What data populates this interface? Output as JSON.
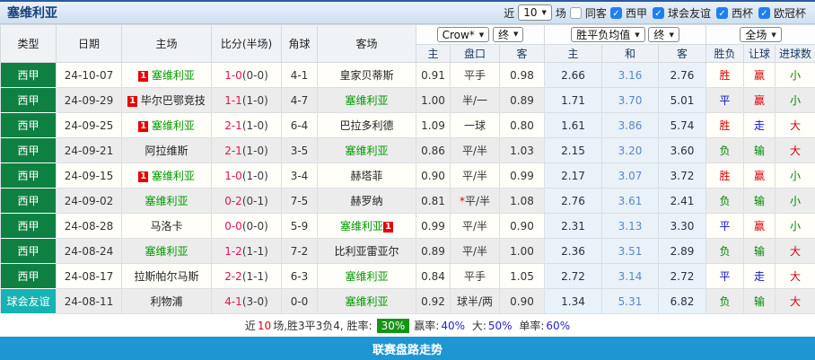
{
  "icons": {
    "caret_down": "▼",
    "check": "✓"
  },
  "title_bar": {
    "team": "塞维利亚",
    "recent_label": "近",
    "recent_value": "10",
    "recent_suffix": "场",
    "same_away_label": "同客",
    "leagues": [
      "西甲",
      "球会友谊",
      "西杯",
      "欧冠杯"
    ]
  },
  "table": {
    "main_headers": [
      "类型",
      "日期",
      "主场",
      "比分(半场)",
      "角球",
      "客场"
    ],
    "selects": {
      "bookmaker": "Crow*",
      "final1": "终",
      "avg_label": "胜平负均值",
      "final2": "终",
      "scope": "全场"
    },
    "sub_headers": [
      "主",
      "盘口",
      "客",
      "主",
      "和",
      "客",
      "胜负",
      "让球",
      "进球数"
    ],
    "rows": [
      {
        "type": "西甲",
        "type_color": "green",
        "date": "24-10-07",
        "home_badge": "1",
        "home": "塞维利亚",
        "home_is_sevilla": true,
        "score_ft": "1-0",
        "score_ht": "(0-0)",
        "corner": "4-1",
        "away": "皇家贝蒂斯",
        "away_is_sevilla": false,
        "away_badge": null,
        "odds_home": "0.91",
        "handicap_prefix": null,
        "handicap": "平手",
        "odds_away": "0.98",
        "avg_home": "2.66",
        "avg_draw": "3.16",
        "avg_away": "2.76",
        "outcome": "胜",
        "outcome_color": "red",
        "handicap_result": "赢",
        "handicap_result_color": "red",
        "goals": "小",
        "goals_color": "green"
      },
      {
        "type": "西甲",
        "type_color": "green",
        "date": "24-09-29",
        "home_badge": "1",
        "home": "毕尔巴鄂竞技",
        "home_is_sevilla": false,
        "score_ft": "1-1",
        "score_ht": "(1-0)",
        "corner": "4-7",
        "away": "塞维利亚",
        "away_is_sevilla": true,
        "away_badge": null,
        "odds_home": "1.00",
        "handicap_prefix": null,
        "handicap": "半/一",
        "odds_away": "0.89",
        "avg_home": "1.71",
        "avg_draw": "3.70",
        "avg_away": "5.01",
        "outcome": "平",
        "outcome_color": "blue",
        "handicap_result": "赢",
        "handicap_result_color": "red",
        "goals": "小",
        "goals_color": "green"
      },
      {
        "type": "西甲",
        "type_color": "green",
        "date": "24-09-25",
        "home_badge": "1",
        "home": "塞维利亚",
        "home_is_sevilla": true,
        "score_ft": "2-1",
        "score_ht": "(1-0)",
        "corner": "6-4",
        "away": "巴拉多利德",
        "away_is_sevilla": false,
        "away_badge": null,
        "odds_home": "1.09",
        "handicap_prefix": null,
        "handicap": "一球",
        "odds_away": "0.80",
        "avg_home": "1.61",
        "avg_draw": "3.86",
        "avg_away": "5.74",
        "outcome": "胜",
        "outcome_color": "red",
        "handicap_result": "走",
        "handicap_result_color": "blue",
        "goals": "大",
        "goals_color": "red"
      },
      {
        "type": "西甲",
        "type_color": "green",
        "date": "24-09-21",
        "home_badge": null,
        "home": "阿拉维斯",
        "home_is_sevilla": false,
        "score_ft": "2-1",
        "score_ht": "(1-0)",
        "corner": "3-5",
        "away": "塞维利亚",
        "away_is_sevilla": true,
        "away_badge": null,
        "odds_home": "0.86",
        "handicap_prefix": null,
        "handicap": "平/半",
        "odds_away": "1.03",
        "avg_home": "2.15",
        "avg_draw": "3.20",
        "avg_away": "3.60",
        "outcome": "负",
        "outcome_color": "green",
        "handicap_result": "输",
        "handicap_result_color": "green",
        "goals": "大",
        "goals_color": "red"
      },
      {
        "type": "西甲",
        "type_color": "green",
        "date": "24-09-15",
        "home_badge": "1",
        "home": "塞维利亚",
        "home_is_sevilla": true,
        "score_ft": "1-0",
        "score_ht": "(1-0)",
        "corner": "3-4",
        "away": "赫塔菲",
        "away_is_sevilla": false,
        "away_badge": null,
        "odds_home": "0.90",
        "handicap_prefix": null,
        "handicap": "平/半",
        "odds_away": "0.99",
        "avg_home": "2.17",
        "avg_draw": "3.07",
        "avg_away": "3.72",
        "outcome": "胜",
        "outcome_color": "red",
        "handicap_result": "赢",
        "handicap_result_color": "red",
        "goals": "小",
        "goals_color": "green"
      },
      {
        "type": "西甲",
        "type_color": "green",
        "date": "24-09-02",
        "home_badge": null,
        "home": "塞维利亚",
        "home_is_sevilla": true,
        "score_ft": "0-2",
        "score_ht": "(0-1)",
        "corner": "7-5",
        "away": "赫罗纳",
        "away_is_sevilla": false,
        "away_badge": null,
        "odds_home": "0.81",
        "handicap_prefix": "*",
        "handicap": "平/半",
        "odds_away": "1.08",
        "avg_home": "2.76",
        "avg_draw": "3.61",
        "avg_away": "2.41",
        "outcome": "负",
        "outcome_color": "green",
        "handicap_result": "输",
        "handicap_result_color": "green",
        "goals": "小",
        "goals_color": "green"
      },
      {
        "type": "西甲",
        "type_color": "green",
        "date": "24-08-28",
        "home_badge": null,
        "home": "马洛卡",
        "home_is_sevilla": false,
        "score_ft": "0-0",
        "score_ht": "(0-0)",
        "corner": "5-9",
        "away": "塞维利亚",
        "away_is_sevilla": true,
        "away_badge": "1",
        "odds_home": "0.99",
        "handicap_prefix": null,
        "handicap": "平/半",
        "odds_away": "0.90",
        "avg_home": "2.31",
        "avg_draw": "3.13",
        "avg_away": "3.30",
        "outcome": "平",
        "outcome_color": "blue",
        "handicap_result": "赢",
        "handicap_result_color": "red",
        "goals": "小",
        "goals_color": "green"
      },
      {
        "type": "西甲",
        "type_color": "green",
        "date": "24-08-24",
        "home_badge": null,
        "home": "塞维利亚",
        "home_is_sevilla": true,
        "score_ft": "1-2",
        "score_ht": "(1-1)",
        "corner": "7-2",
        "away": "比利亚雷亚尔",
        "away_is_sevilla": false,
        "away_badge": null,
        "odds_home": "0.89",
        "handicap_prefix": null,
        "handicap": "平/半",
        "odds_away": "1.00",
        "avg_home": "2.36",
        "avg_draw": "3.51",
        "avg_away": "2.89",
        "outcome": "负",
        "outcome_color": "green",
        "handicap_result": "输",
        "handicap_result_color": "green",
        "goals": "大",
        "goals_color": "red"
      },
      {
        "type": "西甲",
        "type_color": "green",
        "date": "24-08-17",
        "home_badge": null,
        "home": "拉斯帕尔马斯",
        "home_is_sevilla": false,
        "score_ft": "2-2",
        "score_ht": "(1-1)",
        "corner": "6-3",
        "away": "塞维利亚",
        "away_is_sevilla": true,
        "away_badge": null,
        "odds_home": "0.84",
        "handicap_prefix": null,
        "handicap": "平手",
        "odds_away": "1.05",
        "avg_home": "2.72",
        "avg_draw": "3.14",
        "avg_away": "2.72",
        "outcome": "平",
        "outcome_color": "blue",
        "handicap_result": "走",
        "handicap_result_color": "blue",
        "goals": "大",
        "goals_color": "red"
      },
      {
        "type": "球会友谊",
        "type_color": "teal",
        "date": "24-08-11",
        "home_badge": null,
        "home": "利物浦",
        "home_is_sevilla": false,
        "score_ft": "4-1",
        "score_ht": "(3-0)",
        "corner": "0-0",
        "away": "塞维利亚",
        "away_is_sevilla": true,
        "away_badge": null,
        "odds_home": "0.92",
        "handicap_prefix": null,
        "handicap": "球半/两",
        "odds_away": "0.90",
        "avg_home": "1.34",
        "avg_draw": "5.31",
        "avg_away": "6.82",
        "outcome": "负",
        "outcome_color": "green",
        "handicap_result": "输",
        "handicap_result_color": "green",
        "goals": "大",
        "goals_color": "red"
      }
    ]
  },
  "summary": {
    "part1": "近",
    "count": "10",
    "part2": "场,胜3平3负4, 胜率:",
    "rate_badge": "30%",
    "part3": "赢率:",
    "win_pct": "40%",
    "part4": "大:",
    "big_pct": "50%",
    "part5": "单率:",
    "single_pct": "60%"
  },
  "footer": {
    "title": "联赛盘路走势"
  }
}
